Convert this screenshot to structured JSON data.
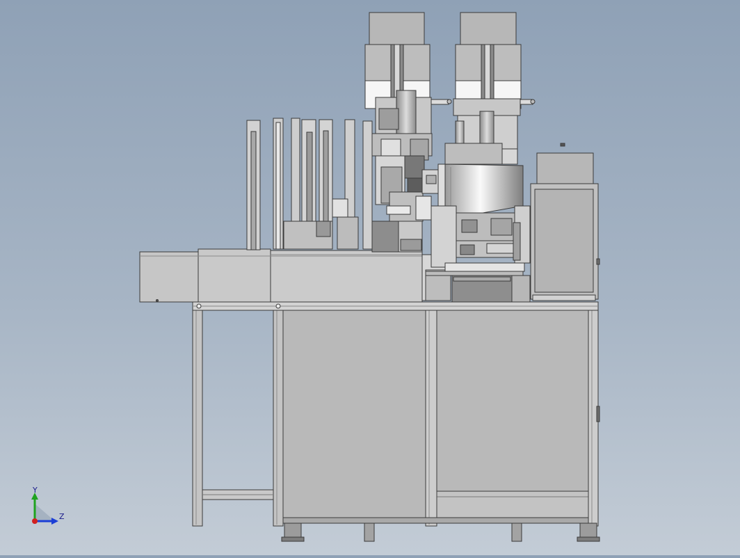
{
  "viewport": {
    "description_hidden": "",
    "background_top": "#8fa1b6",
    "background_bottom": "#c3ccd6"
  },
  "triad": {
    "y_label": "Y",
    "z_label": "Z",
    "y_axis_color": "#1fa31f",
    "z_axis_color": "#1c3fd6",
    "x_axis_color": "#d12020"
  },
  "palette": {
    "steel_light": "#cfcfcf",
    "steel_mid": "#b4b4b4",
    "steel_dark": "#8a8a8a",
    "outline": "#3a3a3a",
    "housing_white": "#f4f4f4",
    "chrome_highlight": "#fafafa"
  }
}
